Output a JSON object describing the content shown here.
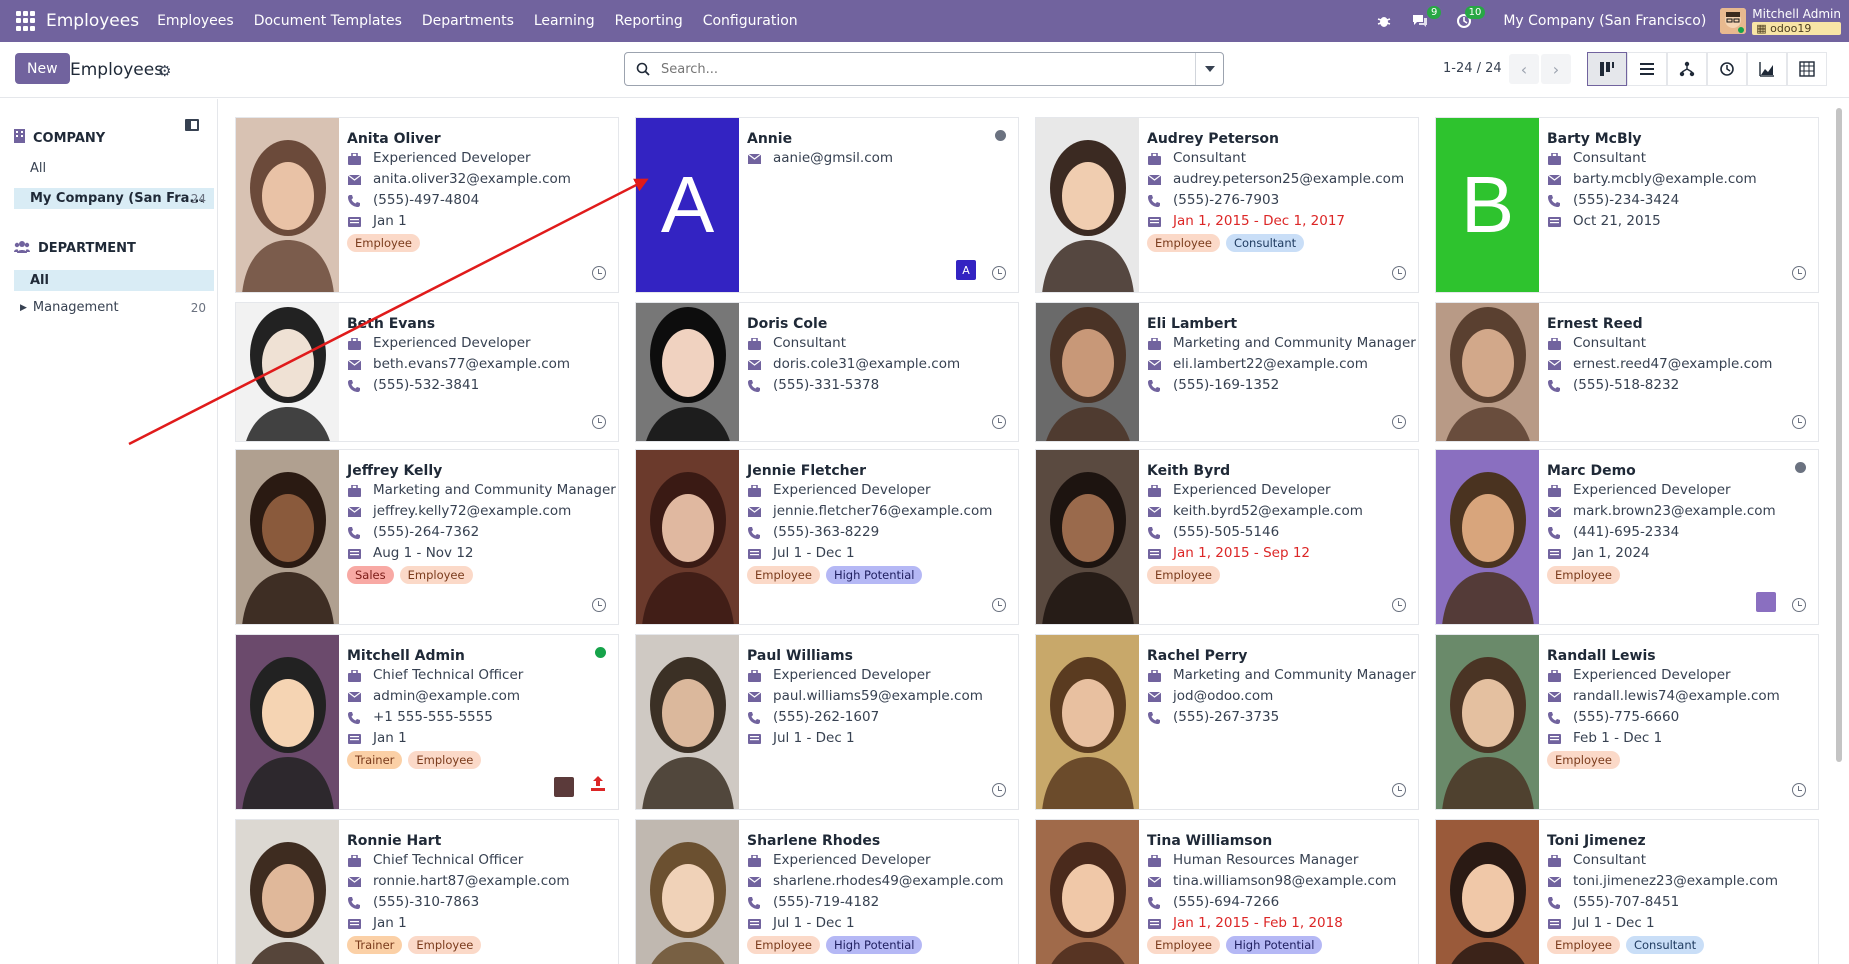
{
  "navbar": {
    "brand": "Employees",
    "menu": [
      "Employees",
      "Document Templates",
      "Departments",
      "Learning",
      "Reporting",
      "Configuration"
    ],
    "chat_count": "9",
    "activity_count": "10",
    "company": "My Company (San Francisco)",
    "user_name": "Mitchell Admin",
    "db_name": "odoo19"
  },
  "control": {
    "new_label": "New",
    "title": "Employees",
    "search_placeholder": "Search...",
    "pager": "1-24 / 24"
  },
  "sidebar": {
    "company_header": "COMPANY",
    "company_items": [
      {
        "label": "All",
        "count": ""
      },
      {
        "label": "My Company (San Fra...",
        "count": "24"
      }
    ],
    "department_header": "DEPARTMENT",
    "department_items": [
      {
        "label": "All",
        "count": ""
      },
      {
        "label": "Management",
        "count": "20"
      }
    ]
  },
  "employees": [
    {
      "name": "Anita Oliver",
      "job": "Experienced Developer",
      "email": "anita.oliver32@example.com",
      "phone": "(555)-497-4804",
      "date": "Jan 1",
      "date_red": false,
      "tags": [
        "Employee"
      ],
      "status": "",
      "mini": ""
    },
    {
      "name": "Annie",
      "job": "",
      "email": "aanie@gmsil.com",
      "phone": "",
      "date": "",
      "date_red": false,
      "tags": [],
      "status": "grey",
      "mini": "A",
      "letter": "A",
      "letter_color": "#3323c2"
    },
    {
      "name": "Audrey Peterson",
      "job": "Consultant",
      "email": "audrey.peterson25@example.com",
      "phone": "(555)-276-7903",
      "date": "Jan 1, 2015 - Dec 1, 2017",
      "date_red": true,
      "tags": [
        "Employee",
        "Consultant"
      ],
      "status": "",
      "mini": ""
    },
    {
      "name": "Barty McBly",
      "job": "Consultant",
      "email": "barty.mcbly@example.com",
      "phone": "(555)-234-3424",
      "date": "Oct 21, 2015",
      "date_red": false,
      "tags": [],
      "status": "",
      "mini": "",
      "letter": "B",
      "letter_color": "#2ec32e"
    },
    {
      "name": "Beth Evans",
      "job": "Experienced Developer",
      "email": "beth.evans77@example.com",
      "phone": "(555)-532-3841",
      "date": "",
      "date_red": false,
      "tags": [],
      "status": "",
      "mini": ""
    },
    {
      "name": "Doris Cole",
      "job": "Consultant",
      "email": "doris.cole31@example.com",
      "phone": "(555)-331-5378",
      "date": "",
      "date_red": false,
      "tags": [],
      "status": "",
      "mini": ""
    },
    {
      "name": "Eli Lambert",
      "job": "Marketing and Community Manager",
      "email": "eli.lambert22@example.com",
      "phone": "(555)-169-1352",
      "date": "",
      "date_red": false,
      "tags": [],
      "status": "",
      "mini": ""
    },
    {
      "name": "Ernest Reed",
      "job": "Consultant",
      "email": "ernest.reed47@example.com",
      "phone": "(555)-518-8232",
      "date": "",
      "date_red": false,
      "tags": [],
      "status": "",
      "mini": ""
    },
    {
      "name": "Jeffrey Kelly",
      "job": "Marketing and Community Manager",
      "email": "jeffrey.kelly72@example.com",
      "phone": "(555)-264-7362",
      "date": "Aug 1 - Nov 12",
      "date_red": false,
      "tags": [
        "Sales",
        "Employee"
      ],
      "status": "",
      "mini": ""
    },
    {
      "name": "Jennie Fletcher",
      "job": "Experienced Developer",
      "email": "jennie.fletcher76@example.com",
      "phone": "(555)-363-8229",
      "date": "Jul 1 - Dec 1",
      "date_red": false,
      "tags": [
        "Employee",
        "High Potential"
      ],
      "status": "",
      "mini": ""
    },
    {
      "name": "Keith Byrd",
      "job": "Experienced Developer",
      "email": "keith.byrd52@example.com",
      "phone": "(555)-505-5146",
      "date": "Jan 1, 2015 - Sep 12",
      "date_red": true,
      "tags": [
        "Employee"
      ],
      "status": "",
      "mini": ""
    },
    {
      "name": "Marc Demo",
      "job": "Experienced Developer",
      "email": "mark.brown23@example.com",
      "phone": "(441)-695-2334",
      "date": "Jan 1, 2024",
      "date_red": false,
      "tags": [
        "Employee"
      ],
      "status": "grey",
      "mini": "photo"
    },
    {
      "name": "Mitchell Admin",
      "job": "Chief Technical Officer",
      "email": "admin@example.com",
      "phone": "+1 555-555-5555",
      "date": "Jan 1",
      "date_red": false,
      "tags": [
        "Trainer",
        "Employee"
      ],
      "status": "green",
      "mini": "admin"
    },
    {
      "name": "Paul Williams",
      "job": "Experienced Developer",
      "email": "paul.williams59@example.com",
      "phone": "(555)-262-1607",
      "date": "Jul 1 - Dec 1",
      "date_red": false,
      "tags": [],
      "status": "",
      "mini": ""
    },
    {
      "name": "Rachel Perry",
      "job": "Marketing and Community Manager",
      "email": "jod@odoo.com",
      "phone": "(555)-267-3735",
      "date": "",
      "date_red": false,
      "tags": [],
      "status": "",
      "mini": ""
    },
    {
      "name": "Randall Lewis",
      "job": "Experienced Developer",
      "email": "randall.lewis74@example.com",
      "phone": "(555)-775-6660",
      "date": "Feb 1 - Dec 1",
      "date_red": false,
      "tags": [
        "Employee"
      ],
      "status": "",
      "mini": ""
    },
    {
      "name": "Ronnie Hart",
      "job": "Chief Technical Officer",
      "email": "ronnie.hart87@example.com",
      "phone": "(555)-310-7863",
      "date": "Jan 1",
      "date_red": false,
      "tags": [
        "Trainer",
        "Employee"
      ],
      "status": "",
      "mini": ""
    },
    {
      "name": "Sharlene Rhodes",
      "job": "Experienced Developer",
      "email": "sharlene.rhodes49@example.com",
      "phone": "(555)-719-4182",
      "date": "Jul 1 - Dec 1",
      "date_red": false,
      "tags": [
        "Employee",
        "High Potential"
      ],
      "status": "",
      "mini": ""
    },
    {
      "name": "Tina Williamson",
      "job": "Human Resources Manager",
      "email": "tina.williamson98@example.com",
      "phone": "(555)-694-7266",
      "date": "Jan 1, 2015 - Feb 1, 2018",
      "date_red": true,
      "tags": [
        "Employee",
        "High Potential"
      ],
      "status": "",
      "mini": ""
    },
    {
      "name": "Toni Jimenez",
      "job": "Consultant",
      "email": "toni.jimenez23@example.com",
      "phone": "(555)-707-8451",
      "date": "Jul 1 - Dec 1",
      "date_red": false,
      "tags": [
        "Employee",
        "Consultant"
      ],
      "status": "",
      "mini": ""
    }
  ],
  "colors": {
    "brand": "#71639e",
    "status_green": "#16a34a",
    "status_grey": "#6b7280",
    "annotation_arrow": "#e01b1b"
  }
}
